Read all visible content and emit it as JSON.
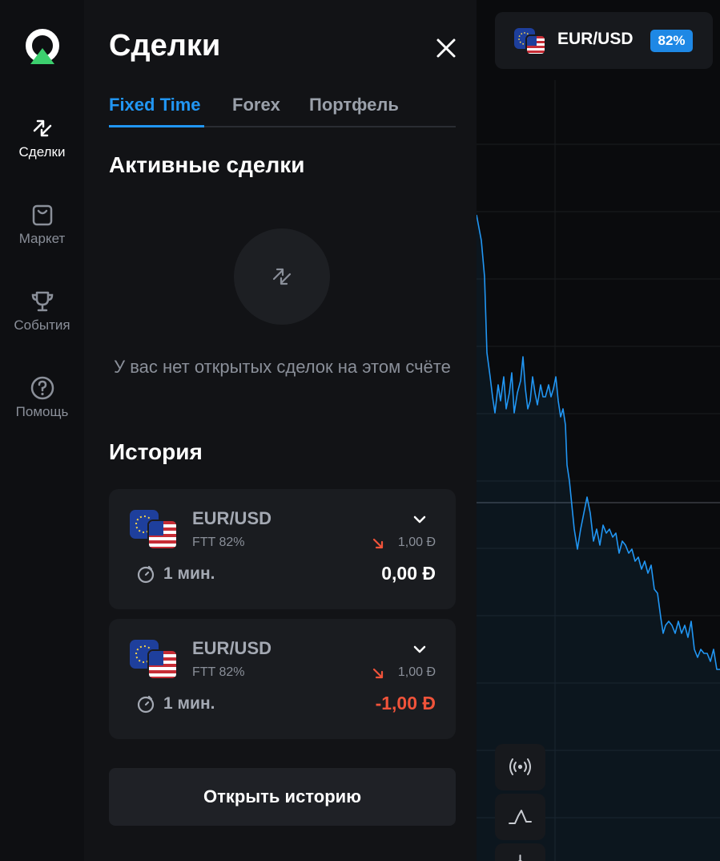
{
  "rail": {
    "items": [
      {
        "label": "Сделки",
        "icon": "arrows-exchange-icon",
        "active": true
      },
      {
        "label": "Маркет",
        "icon": "shopping-bag-icon",
        "active": false
      },
      {
        "label": "События",
        "icon": "trophy-icon",
        "active": false
      },
      {
        "label": "Помощь",
        "icon": "help-circle-icon",
        "active": false
      }
    ]
  },
  "panel": {
    "title": "Сделки",
    "tabs": [
      {
        "label": "Fixed Time",
        "active": true
      },
      {
        "label": "Forex",
        "active": false
      },
      {
        "label": "Портфель",
        "active": false
      }
    ],
    "active_title": "Активные сделки",
    "empty_text": "У вас нет открытых сделок на этом счёте",
    "history_title": "История",
    "history": [
      {
        "pair": "EUR/USD",
        "type": "FTT 82%",
        "direction": "down",
        "amount": "1,00 Đ",
        "duration": "1 мин.",
        "result": "0,00 Đ",
        "result_color": "#ffffff"
      },
      {
        "pair": "EUR/USD",
        "type": "FTT 82%",
        "direction": "down",
        "amount": "1,00 Đ",
        "duration": "1 мин.",
        "result": "-1,00 Đ",
        "result_color": "#f0533a"
      }
    ],
    "open_history_label": "Открыть историю"
  },
  "chart": {
    "pair": "EUR/USD",
    "payout": "82%",
    "line_color": "#2196f3",
    "tools": [
      "live-signal-icon",
      "line-chart-icon",
      "indicator-icon"
    ]
  },
  "colors": {
    "accent": "#2196f3",
    "loss": "#f0533a",
    "logo_green": "#3ccf6e"
  }
}
